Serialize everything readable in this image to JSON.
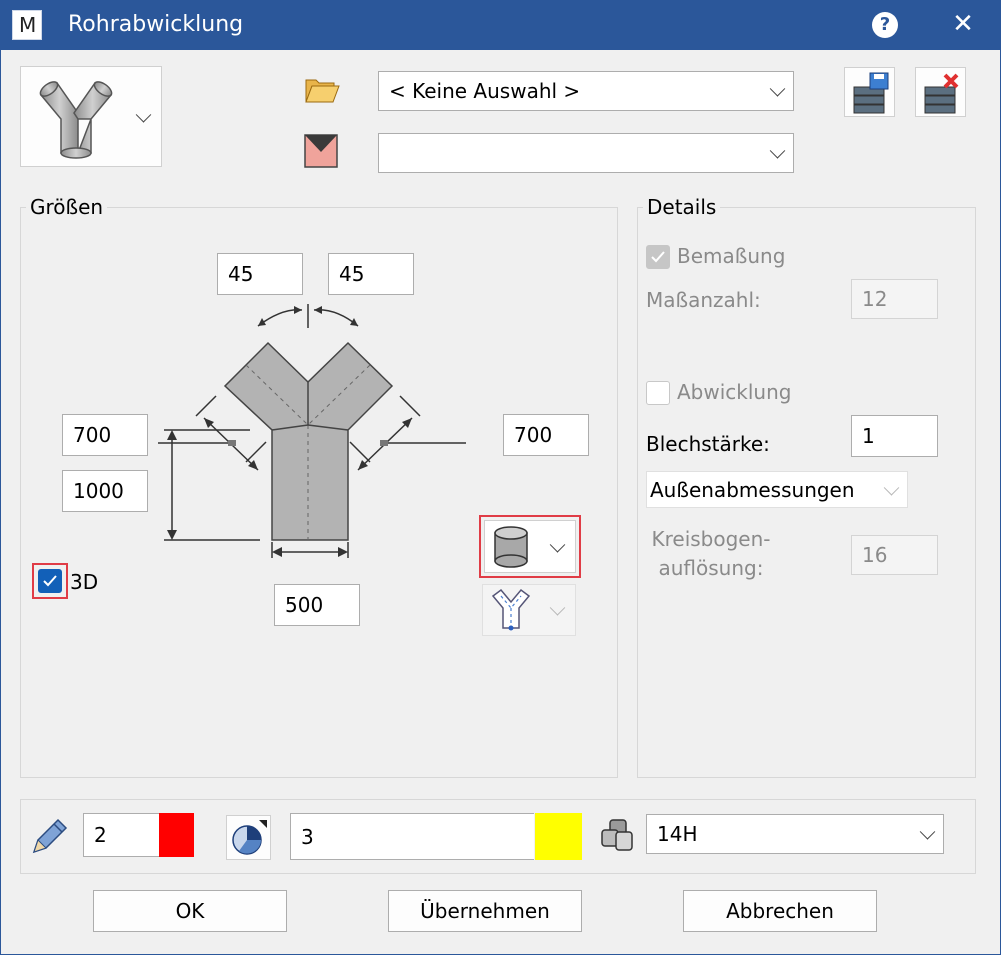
{
  "window": {
    "title": "Rohrabwicklung"
  },
  "top": {
    "profile_select": "< Keine Auswahl >",
    "second_select": ""
  },
  "groessen": {
    "title": "Größen",
    "angle_left": "45",
    "angle_right": "45",
    "length_left": "700",
    "length_right": "700",
    "height": "1000",
    "width": "500",
    "check_3d_label": "3D",
    "check_3d": true
  },
  "details": {
    "title": "Details",
    "bemassung_label": "Bemaßung",
    "bemassung_checked": true,
    "masszahl_label": "Maßanzahl:",
    "masszahl_value": "12",
    "abwicklung_label": "Abwicklung",
    "abwicklung_checked": false,
    "blechstaerke_label": "Blechstärke:",
    "blechstaerke_value": "1",
    "aussen_select": "Außenabmessungen",
    "kreisbogen_label_1": "Kreisbogen-",
    "kreisbogen_label_2": "auflösung:",
    "kreisbogen_value": "16"
  },
  "bottom": {
    "pen_value": "2",
    "pen_color": "#ff0000",
    "line_value": "3",
    "line_color": "#ffff00",
    "layer_select": "14H"
  },
  "buttons": {
    "ok": "OK",
    "apply": "Übernehmen",
    "cancel": "Abbrechen"
  },
  "colors": {
    "titlebar": "#2b579a",
    "highlight": "#e03c46",
    "checkbox_blue": "#1260b8"
  }
}
